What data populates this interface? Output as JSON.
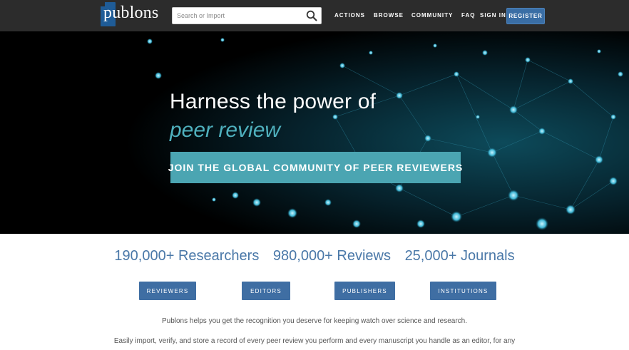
{
  "header": {
    "logo_text": "publons",
    "search_placeholder": "Search or Import",
    "nav": [
      "ACTIONS",
      "BROWSE",
      "COMMUNITY",
      "FAQ"
    ],
    "sign_in": "SIGN IN",
    "register": "REGISTER"
  },
  "hero": {
    "title": "Harness the power of",
    "subtitle": "peer review",
    "cta": "JOIN THE GLOBAL COMMUNITY OF PEER REVIEWERS"
  },
  "stats": [
    "190,000+ Researchers",
    "980,000+ Reviews",
    "25,000+ Journals"
  ],
  "roles": [
    "REVIEWERS",
    "EDITORS",
    "PUBLISHERS",
    "INSTITUTIONS"
  ],
  "content": {
    "paragraph1": "Publons helps you get the recognition you deserve for keeping watch over science and research.",
    "paragraph2": "Easily import, verify, and store a record of every peer review you perform and every manuscript you handle as an editor, for any"
  },
  "colors": {
    "topbar": "#2c2c2c",
    "brand_blue": "#3a6ea5",
    "teal": "#4ba5b2",
    "stats_text": "#4a78a8"
  }
}
